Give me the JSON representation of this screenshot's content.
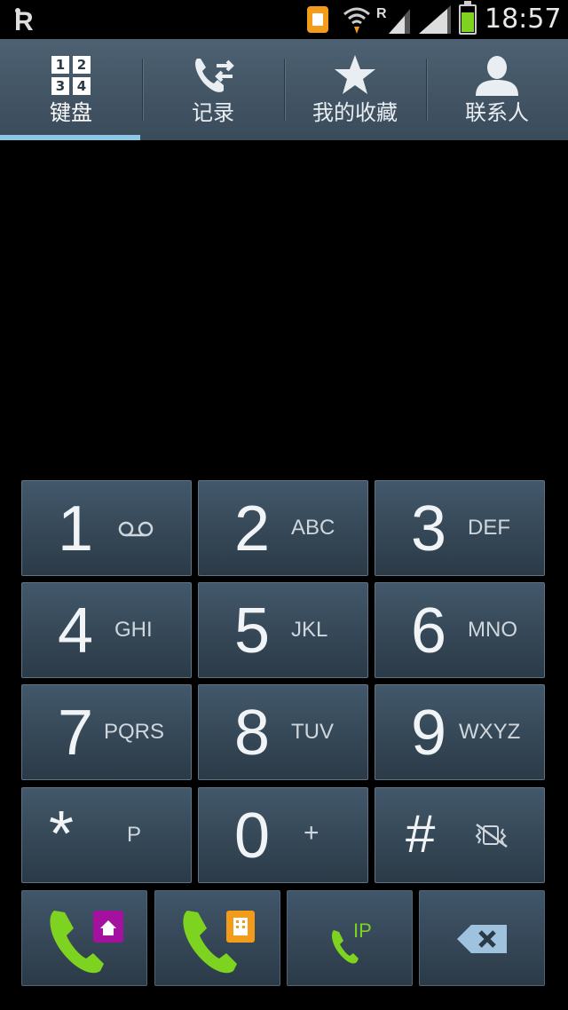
{
  "status_bar": {
    "time": "18:57",
    "battery_level": 0.75,
    "roaming_label": "R",
    "icons": [
      "app-logo-icon",
      "sim-card-icon",
      "wifi-icon",
      "roaming-signal-icon",
      "signal-icon",
      "battery-icon"
    ]
  },
  "tabs": [
    {
      "label": "键盘",
      "icon": "keypad-icon",
      "active": true
    },
    {
      "label": "记录",
      "icon": "call-log-icon",
      "active": false
    },
    {
      "label": "我的收藏",
      "icon": "star-icon",
      "active": false
    },
    {
      "label": "联系人",
      "icon": "contact-icon",
      "active": false
    }
  ],
  "keypad_mini_digits": [
    "1",
    "2",
    "3",
    "4"
  ],
  "keys": [
    {
      "digit": "1",
      "letters": "",
      "sub_icon": "voicemail-icon"
    },
    {
      "digit": "2",
      "letters": "ABC"
    },
    {
      "digit": "3",
      "letters": "DEF"
    },
    {
      "digit": "4",
      "letters": "GHI"
    },
    {
      "digit": "5",
      "letters": "JKL"
    },
    {
      "digit": "6",
      "letters": "MNO"
    },
    {
      "digit": "7",
      "letters": "PQRS"
    },
    {
      "digit": "8",
      "letters": "TUV"
    },
    {
      "digit": "9",
      "letters": "WXYZ"
    },
    {
      "digit": "*",
      "letters": "P"
    },
    {
      "digit": "0",
      "letters": "+"
    },
    {
      "digit": "#",
      "letters": "",
      "sub_icon": "vibrate-mute-icon"
    }
  ],
  "actions": [
    {
      "name": "call-home-sim",
      "icon": "phone-home-icon"
    },
    {
      "name": "call-work-sim",
      "icon": "phone-work-icon"
    },
    {
      "name": "ip-call",
      "icon": "phone-ip-icon",
      "label": "IP"
    },
    {
      "name": "backspace",
      "icon": "backspace-icon"
    }
  ],
  "colors": {
    "call_green": "#7ed321",
    "sim_orange": "#f39c1c",
    "sim_purple": "#a3119e",
    "tab_active_underline": "#8ec6e8",
    "key_background": "#3a4d5c"
  }
}
